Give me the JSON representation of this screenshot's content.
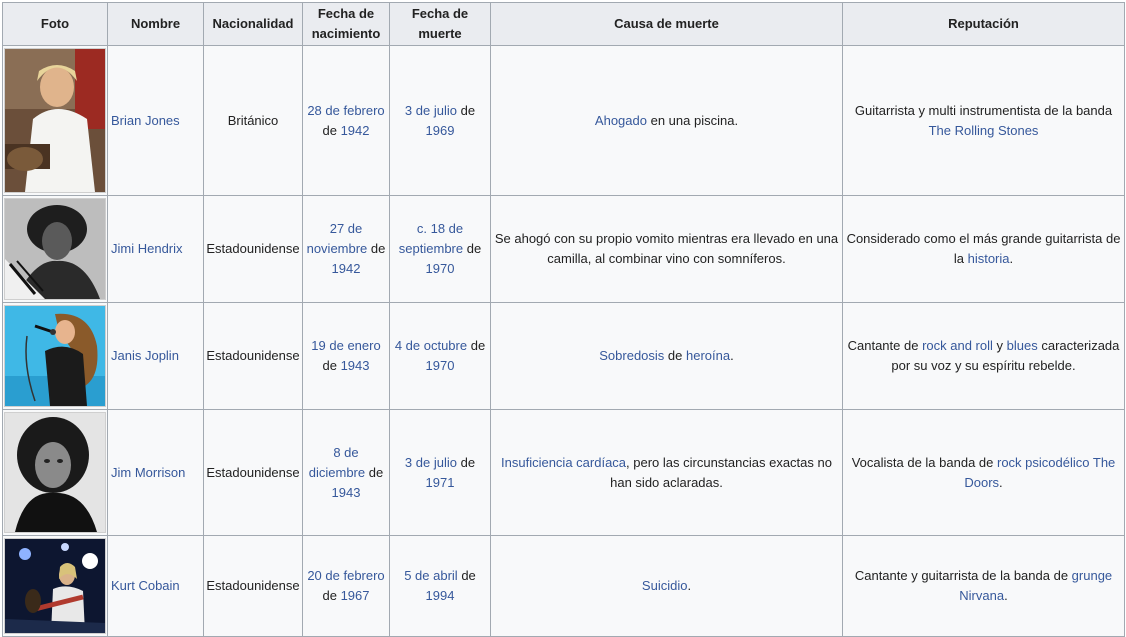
{
  "headers": {
    "foto": "Foto",
    "nombre": "Nombre",
    "nacionalidad": "Nacionalidad",
    "nacimiento": "Fecha de nacimiento",
    "muerte": "Fecha de muerte",
    "causa": "Causa de muerte",
    "reputacion": "Reputación"
  },
  "rows": [
    {
      "photo_icon": "brian-jones-photo",
      "name": "Brian Jones",
      "nationality": "Británico",
      "birth_date": "28 de febrero",
      "birth_sep": "de",
      "birth_year": "1942",
      "death_date": "3 de julio",
      "death_sep": "de",
      "death_year": "1969",
      "cause_link": "Ahogado",
      "cause_text": "en una piscina.",
      "rep_text": "Guitarrista y multi instrumentista de la banda",
      "rep_link": "The Rolling Stones"
    },
    {
      "photo_icon": "jimi-hendrix-photo",
      "name": "Jimi Hendrix",
      "nationality": "Estadounidense",
      "birth_date": "27 de noviembre",
      "birth_sep": "de",
      "birth_year": "1942",
      "death_date": "c. 18 de septiembre",
      "death_sep": "de",
      "death_year": "1970",
      "cause_text": "Se ahogó con su propio vomito mientras era llevado en una camilla, al combinar vino con somníferos.",
      "rep_text": "Considerado como el más grande guitarrista de la",
      "rep_link": "historia",
      "rep_end": "."
    },
    {
      "photo_icon": "janis-joplin-photo",
      "name": "Janis Joplin",
      "nationality": "Estadounidense",
      "birth_date": "19 de enero",
      "birth_sep": "de",
      "birth_year": "1943",
      "death_date": "4 de octubre",
      "death_sep": "de",
      "death_year": "1970",
      "cause_link1": "Sobredosis",
      "cause_mid": "de",
      "cause_link2": "heroína",
      "cause_end": ".",
      "rep_text1": "Cantante de",
      "rep_link1": "rock and roll",
      "rep_mid": "y",
      "rep_link2": "blues",
      "rep_text2": "caracterizada por su voz y su espíritu rebelde."
    },
    {
      "photo_icon": "jim-morrison-photo",
      "name": "Jim Morrison",
      "nationality": "Estadounidense",
      "birth_date": "8 de diciembre",
      "birth_sep": "de",
      "birth_year": "1943",
      "death_date": "3 de julio",
      "death_sep": "de",
      "death_year": "1971",
      "cause_link": "Insuficiencia cardíaca",
      "cause_text": ", pero las circunstancias exactas no han sido aclaradas.",
      "rep_text": "Vocalista de la banda de",
      "rep_link1": "rock psicodélico",
      "rep_link2": "The Doors",
      "rep_end": "."
    },
    {
      "photo_icon": "kurt-cobain-photo",
      "name": "Kurt Cobain",
      "nationality": "Estadounidense",
      "birth_date": "20 de febrero",
      "birth_sep": "de",
      "birth_year": "1967",
      "death_date": "5 de abril",
      "death_sep": "de",
      "death_year": "1994",
      "cause_link": "Suicidio",
      "cause_end": ".",
      "rep_text": "Cantante y guitarrista de la banda de",
      "rep_link1": "grunge",
      "rep_link2": "Nirvana",
      "rep_end": "."
    }
  ],
  "colors": {
    "link": "#36589b",
    "header_bg": "#eaecf0",
    "cell_bg": "#f8f9fa",
    "border": "#a2a9b1"
  }
}
